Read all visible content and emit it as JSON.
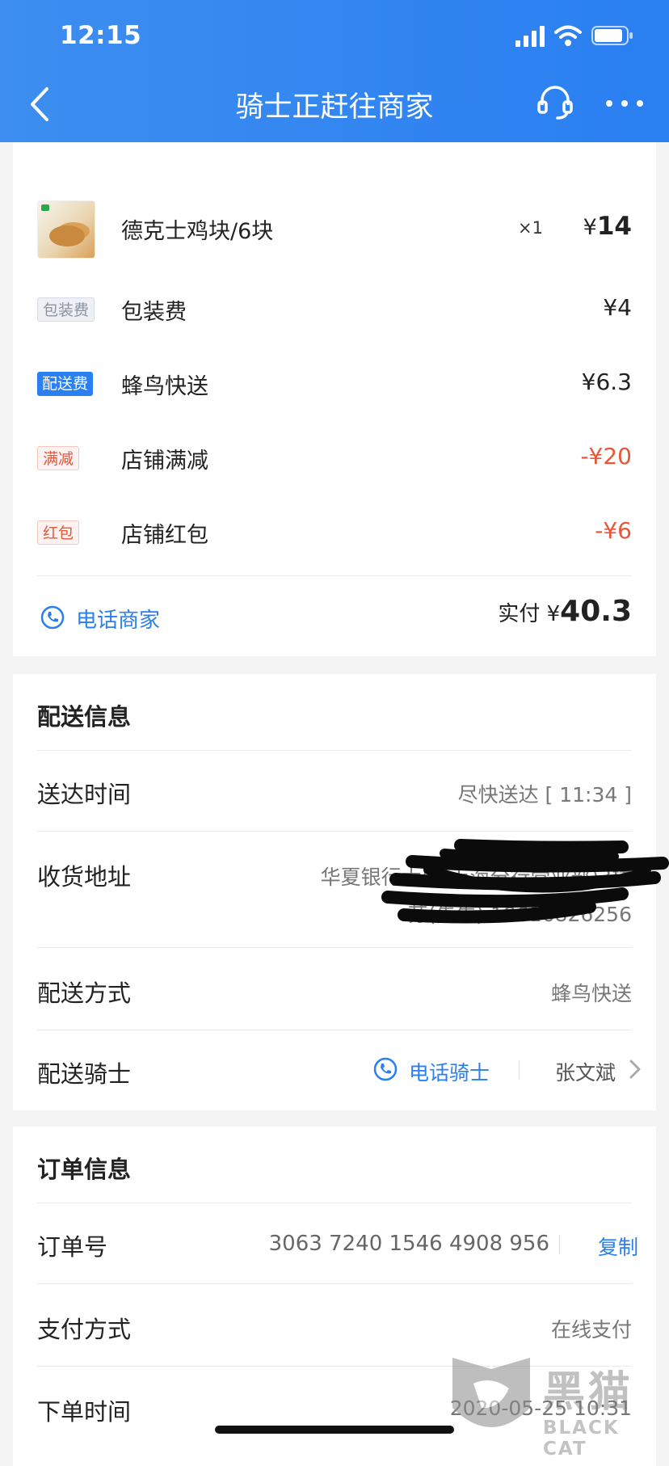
{
  "status_bar": {
    "time": "12:15"
  },
  "nav": {
    "title": "骑士正赶往商家"
  },
  "order_items": [
    {
      "name": "德克士鸡块/6块",
      "qty": "×1",
      "price_symbol": "¥",
      "price": "14"
    }
  ],
  "fees": [
    {
      "tag": "包装费",
      "label": "包装费",
      "amount": "¥4",
      "style": "gray"
    },
    {
      "tag": "配送费",
      "label": "蜂鸟快送",
      "amount": "¥6.3",
      "style": "blue"
    },
    {
      "tag": "满减",
      "label": "店铺满减",
      "amount": "-¥20",
      "style": "red"
    },
    {
      "tag": "红包",
      "label": "店铺红包",
      "amount": "-¥6",
      "style": "red"
    }
  ],
  "summary": {
    "call_shop": "电话商家",
    "paid_label": "实付 ¥",
    "paid_amount": "40.3"
  },
  "delivery": {
    "title": "配送信息",
    "time_label": "送达时间",
    "time_value": "尽快送达 [ 11:34 ]",
    "address_label": "收货地址",
    "address_line1": "华夏银行大厦(上海分行营业部)3楼",
    "address_line2": "苏(先生) 18616826256",
    "method_label": "配送方式",
    "method_value": "蜂鸟快送",
    "rider_label": "配送骑士",
    "rider_call": "电话骑士",
    "rider_name": "张文斌"
  },
  "order_info": {
    "title": "订单信息",
    "number_label": "订单号",
    "number_value": "3063 7240 1546 4908 956",
    "copy": "复制",
    "pay_label": "支付方式",
    "pay_value": "在线支付",
    "time_label": "下单时间",
    "time_value": "2020-05-25 10:31"
  },
  "watermark": {
    "text": "黑猫",
    "sub": "BLACK CAT"
  },
  "colors": {
    "accent": "#2a7ff1",
    "discount": "#e5563b"
  }
}
